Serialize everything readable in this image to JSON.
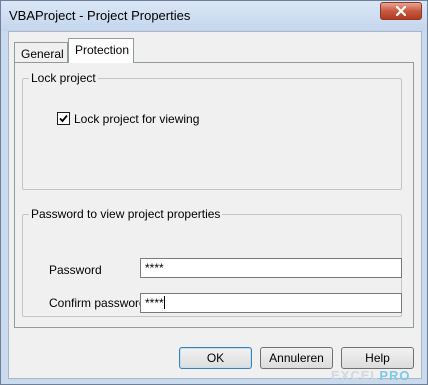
{
  "window": {
    "title": "VBAProject - Project Properties"
  },
  "tabs": [
    {
      "label": "General",
      "active": false
    },
    {
      "label": "Protection",
      "active": true
    }
  ],
  "lock_group": {
    "legend": "Lock project",
    "checkbox_label": "Lock project for viewing",
    "checked": true
  },
  "password_group": {
    "legend": "Password to view project properties",
    "password_label": "Password",
    "password_value": "****",
    "confirm_label": "Confirm password",
    "confirm_value": "****"
  },
  "buttons": {
    "ok": "OK",
    "cancel": "Annuleren",
    "help": "Help"
  },
  "watermark": {
    "prefix": "EXCEL",
    "suffix": "PRO"
  },
  "colors": {
    "titlebar": "#c9d9ee",
    "close": "#c85a40",
    "face": "#f0f0f0"
  },
  "icons": {
    "close": "close-icon",
    "check": "checkmark-icon"
  }
}
